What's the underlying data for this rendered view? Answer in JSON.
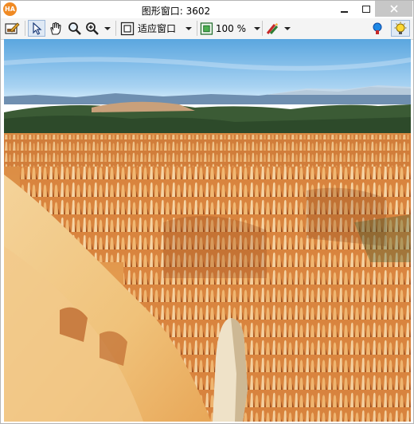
{
  "window": {
    "app_icon_text": "HA",
    "title": "图形窗口: 3602"
  },
  "toolbar": {
    "fit_label": "适应窗口",
    "zoom_label": "100 %"
  },
  "colors": {
    "sky_top": "#5aa6df",
    "sky_bottom": "#d9eefb",
    "rock_orange": "#e08a3c",
    "rock_light": "#f3d6a6",
    "forest": "#2d4a2a"
  }
}
